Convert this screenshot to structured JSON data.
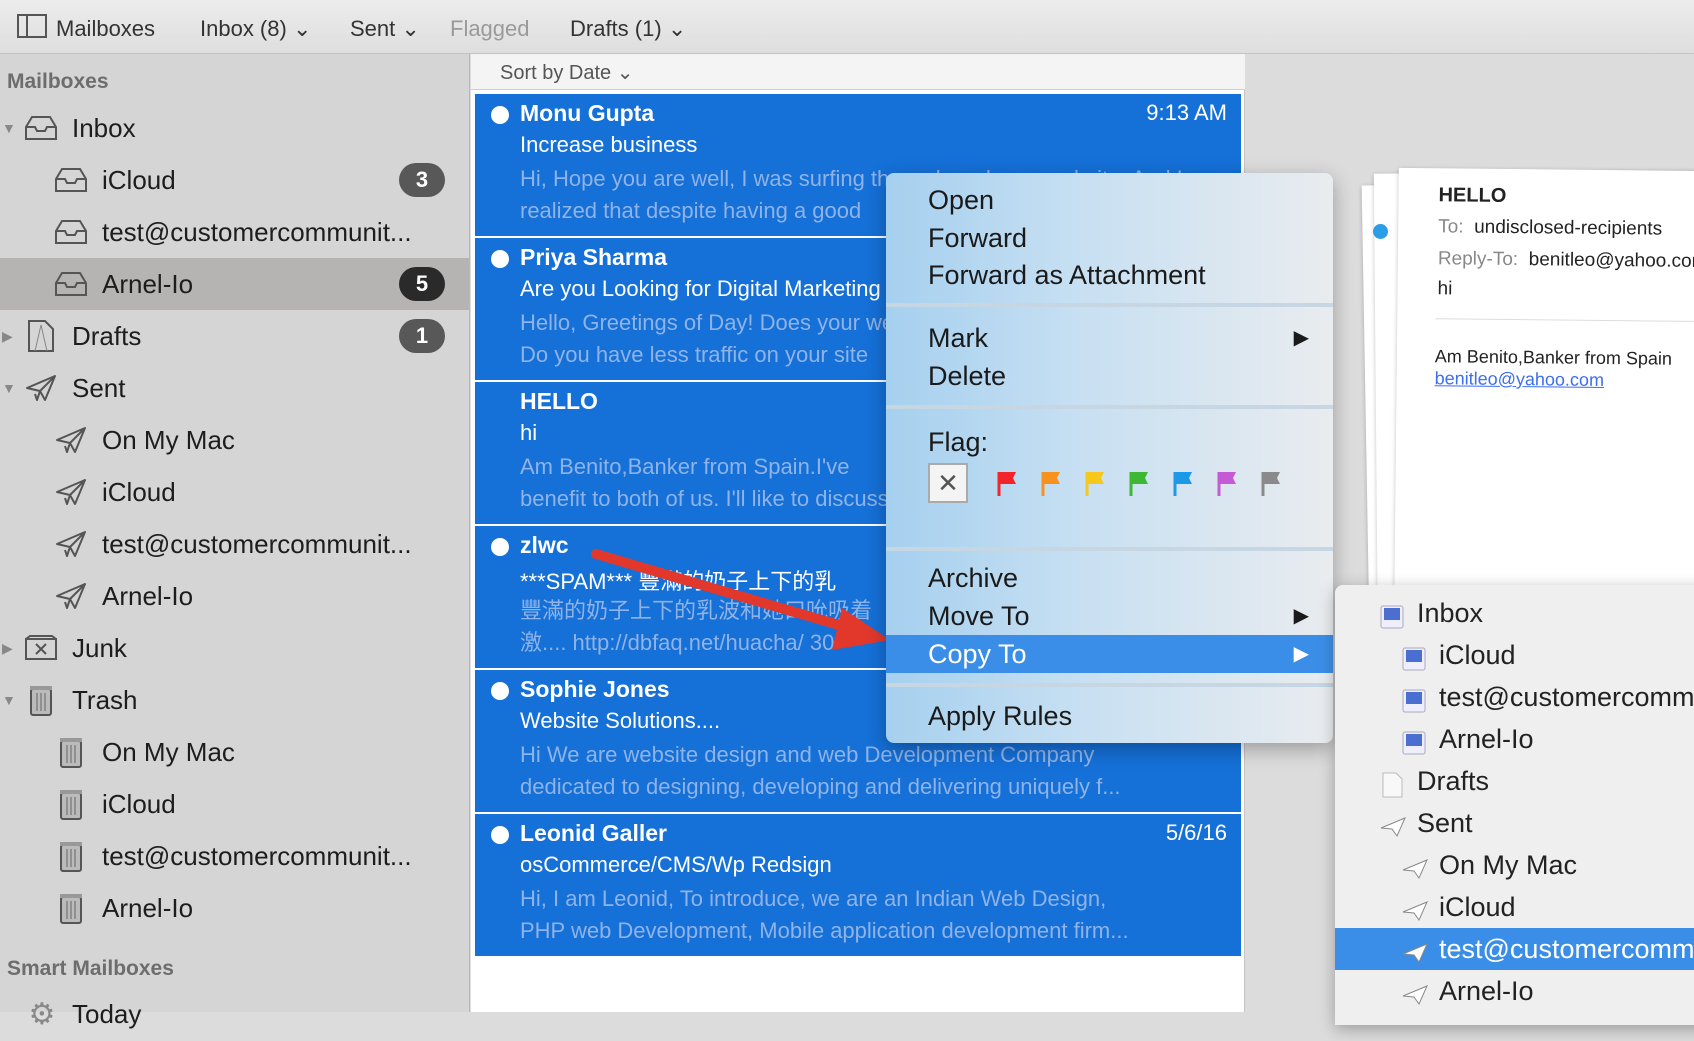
{
  "toolbar": {
    "mailboxes": "Mailboxes",
    "inbox": "Inbox (8)",
    "sent": "Sent",
    "flagged": "Flagged",
    "drafts": "Drafts (1)"
  },
  "sidebar": {
    "header": "Mailboxes",
    "smart_header": "Smart Mailboxes",
    "smart_today": "Today",
    "items": [
      {
        "label": "Inbox",
        "icon": "inbox-icon",
        "level": 0,
        "expand": "open"
      },
      {
        "label": "iCloud",
        "icon": "inbox-icon",
        "level": 1,
        "badge": "3"
      },
      {
        "label": "test@customercommunit...",
        "icon": "inbox-icon",
        "level": 1
      },
      {
        "label": "Arnel-Io",
        "icon": "inbox-icon",
        "level": 1,
        "badge": "5",
        "selected": true
      },
      {
        "label": "Drafts",
        "icon": "drafts-icon",
        "level": 0,
        "expand": "closed",
        "badge": "1"
      },
      {
        "label": "Sent",
        "icon": "sent-icon",
        "level": 0,
        "expand": "open"
      },
      {
        "label": "On My Mac",
        "icon": "sent-icon",
        "level": 1
      },
      {
        "label": "iCloud",
        "icon": "sent-icon",
        "level": 1
      },
      {
        "label": "test@customercommunit...",
        "icon": "sent-icon",
        "level": 1
      },
      {
        "label": "Arnel-Io",
        "icon": "sent-icon",
        "level": 1
      },
      {
        "label": "Junk",
        "icon": "junk-icon",
        "level": 0,
        "expand": "closed"
      },
      {
        "label": "Trash",
        "icon": "trash-icon",
        "level": 0,
        "expand": "open"
      },
      {
        "label": "On My Mac",
        "icon": "trash-icon",
        "level": 1
      },
      {
        "label": "iCloud",
        "icon": "trash-icon",
        "level": 1
      },
      {
        "label": "test@customercommunit...",
        "icon": "trash-icon",
        "level": 1
      },
      {
        "label": "Arnel-Io",
        "icon": "trash-icon",
        "level": 1
      }
    ]
  },
  "sort": {
    "label": "Sort by Date"
  },
  "messages": [
    {
      "from": "Monu Gupta",
      "date": "9:13 AM",
      "subject": "Increase business",
      "preview": [
        "Hi, Hope you are well, I was surfing the web and your website. And I",
        "realized that despite having a good"
      ],
      "unread": true
    },
    {
      "from": "Priya Sharma",
      "date": "",
      "subject": "Are you Looking for Digital Marketing",
      "preview": [
        "Hello, Greetings of Day! Does your website",
        "Do you have less traffic on your site"
      ],
      "unread": true
    },
    {
      "from": "HELLO",
      "date": "",
      "subject": "hi",
      "preview": [
        "Am Benito,Banker from Spain.I've",
        "benefit to both of us. I'll like to discuss"
      ],
      "unread": false
    },
    {
      "from": "zlwc",
      "date": "",
      "subject": "***SPAM***  豐滿的奶子上下的乳",
      "preview": [
        "豐滿的奶子上下的乳波和她口吮吸着",
        "激.... http://dbfaq.net/huacha/ 30"
      ],
      "unread": true
    },
    {
      "from": "Sophie Jones",
      "date": "",
      "subject": "Website Solutions....",
      "preview": [
        "Hi We are website design and web Development Company",
        "dedicated to designing, developing and delivering uniquely f..."
      ],
      "unread": true
    },
    {
      "from": "Leonid Galler",
      "date": "5/6/16",
      "subject": "osCommerce/CMS/Wp Redsign",
      "preview": [
        "Hi, I am Leonid, To introduce, we are an Indian Web Design,",
        "PHP web Development, Mobile application development firm..."
      ],
      "unread": true
    }
  ],
  "preview": {
    "subject": "HELLO",
    "to_label": "To:",
    "to": "undisclosed-recipients",
    "replyto_label": "Reply-To:",
    "replyto": "benitleo@yahoo.com",
    "body": "hi",
    "sig": "Am Benito,Banker from Spain",
    "link": "benitleo@yahoo.com"
  },
  "context_menu": {
    "open": "Open",
    "forward": "Forward",
    "forward_attachment": "Forward as Attachment",
    "mark": "Mark",
    "delete": "Delete",
    "flag": "Flag:",
    "archive": "Archive",
    "move_to": "Move To",
    "copy_to": "Copy To",
    "apply_rules": "Apply Rules",
    "flag_colors": [
      "#f2242a",
      "#f7921e",
      "#f7c81c",
      "#3cb832",
      "#1c9ae8",
      "#c659d6",
      "#8a8a8a"
    ]
  },
  "submenu": {
    "items": [
      {
        "label": "Inbox",
        "icon": "inbox",
        "level": 0
      },
      {
        "label": "iCloud",
        "icon": "inbox",
        "level": 1
      },
      {
        "label": "test@customercommunity",
        "icon": "inbox",
        "level": 1
      },
      {
        "label": "Arnel-Io",
        "icon": "inbox",
        "level": 1
      },
      {
        "label": "Drafts",
        "icon": "drafts",
        "level": 0
      },
      {
        "label": "Sent",
        "icon": "sent",
        "level": 0
      },
      {
        "label": "On My Mac",
        "icon": "sent",
        "level": 1
      },
      {
        "label": "iCloud",
        "icon": "sent",
        "level": 1
      },
      {
        "label": "test@customercommunity",
        "icon": "sent",
        "level": 1,
        "highlighted": true
      },
      {
        "label": "Arnel-Io",
        "icon": "sent",
        "level": 1
      }
    ]
  }
}
